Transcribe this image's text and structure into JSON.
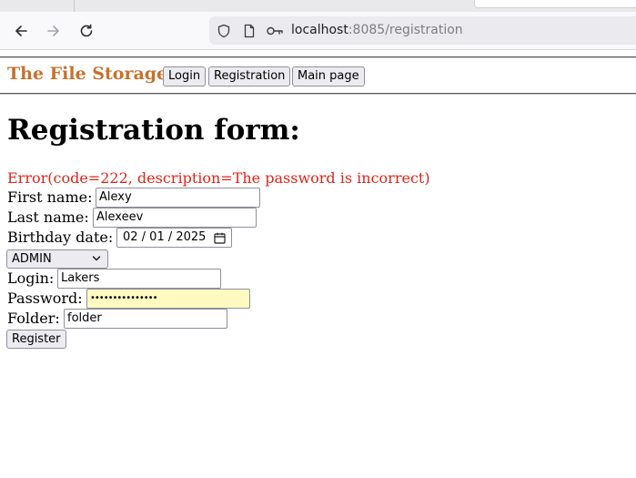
{
  "browser": {
    "url_host": "localhost",
    "url_rest": ":8085/registration"
  },
  "header": {
    "brand": "The File Storage",
    "nav": [
      "Login",
      "Registration",
      "Main page"
    ]
  },
  "form": {
    "title": "Registration form:",
    "error": "Error(code=222, description=The password is incorrect)",
    "first_name_label": "First name:",
    "first_name_value": "Alexy",
    "last_name_label": "Last name:",
    "last_name_value": "Alexeev",
    "birthday_label": "Birthday date:",
    "birthday_value": "02 / 01 / 2025",
    "role_value": "ADMIN",
    "login_label": "Login:",
    "login_value": "Lakers",
    "password_label": "Password:",
    "password_value": "•••••••••••••••",
    "folder_label": "Folder:",
    "folder_value": "folder",
    "register_label": "Register"
  },
  "colors": {
    "brand": "#c8702e",
    "error": "#e2231a",
    "password_autofill_bg": "#fffbc0"
  },
  "icons": [
    "back-arrow-icon",
    "forward-arrow-icon",
    "reload-icon",
    "shield-icon",
    "page-icon",
    "key-icon",
    "calendar-icon",
    "chevron-down-icon"
  ]
}
